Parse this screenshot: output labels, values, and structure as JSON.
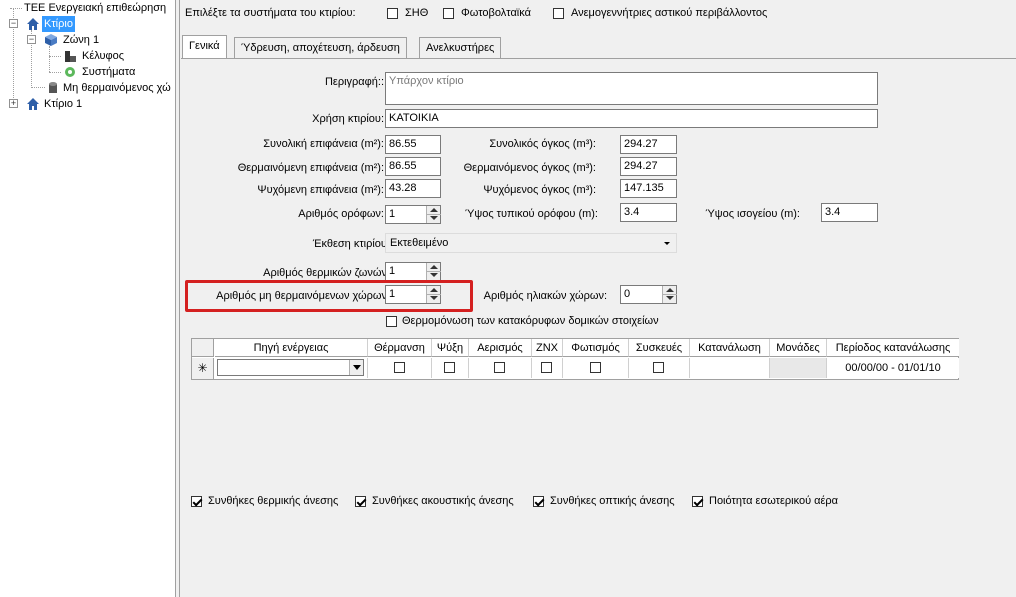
{
  "tree": {
    "items": [
      {
        "label": "ΤΕΕ Ενεργειακή επιθεώρηση",
        "icon": "root-dots"
      },
      {
        "label": "Κτίριο",
        "icon": "house-icon",
        "selected": true
      },
      {
        "label": "Ζώνη 1",
        "icon": "cube-icon"
      },
      {
        "label": "Κέλυφος",
        "icon": "wall-icon"
      },
      {
        "label": "Συστήματα",
        "icon": "systems-icon"
      },
      {
        "label": "Μη θερμαινόμενος χώ",
        "icon": "cylinder-icon"
      },
      {
        "label": "Κτίριο 1",
        "icon": "house-icon"
      }
    ]
  },
  "systems_bar": {
    "label": "Επιλέξτε τα συστήματα του κτιρίου:",
    "options": [
      {
        "label": "ΣΗΘ",
        "checked": false
      },
      {
        "label": "Φωτοβολταϊκά",
        "checked": false
      },
      {
        "label": "Ανεμογεννήτριες αστικού περιβάλλοντος",
        "checked": false
      }
    ]
  },
  "tabs": [
    {
      "label": "Γενικά",
      "active": true
    },
    {
      "label": "Ύδρευση, αποχέτευση, άρδευση",
      "active": false
    },
    {
      "label": "Ανελκυστήρες",
      "active": false
    }
  ],
  "form": {
    "description_label": "Περιγραφή::",
    "description_value": "Υπάρχον κτίριο",
    "usage_label": "Χρήση κτιρίου:",
    "usage_value": "ΚΑΤΟΙΚΙΑ",
    "total_area_label": "Συνολική επιφάνεια (m²):",
    "total_area": "86.55",
    "total_volume_label": "Συνολικός όγκος (m³):",
    "total_volume": "294.27",
    "heated_area_label": "Θερμαινόμενη επιφάνεια (m²):",
    "heated_area": "86.55",
    "heated_volume_label": "Θερμαινόμενος όγκος (m³):",
    "heated_volume": "294.27",
    "cooled_area_label": "Ψυχόμενη επιφάνεια (m²):",
    "cooled_area": "43.28",
    "cooled_volume_label": "Ψυχόμενος όγκος (m³):",
    "cooled_volume": "147.135",
    "floors_label": "Αριθμός ορόφων:",
    "floors": "1",
    "floor_height_label": "Ύψος τυπικού ορόφου (m):",
    "floor_height": "3.4",
    "ground_height_label": "Ύψος ισογείου (m):",
    "ground_height": "3.4",
    "exposure_label": "Έκθεση κτιρίου:",
    "exposure_value": "Εκτεθειμένο",
    "thermal_zones_label": "Αριθμός θερμικών ζωνών:",
    "thermal_zones": "1",
    "unheated_spaces_label": "Αριθμός μη θερμαινόμενων χώρων:",
    "unheated_spaces": "1",
    "solar_spaces_label": "Αριθμός ηλιακών χώρων:",
    "solar_spaces": "0",
    "insulation_label": "Θερμομόνωση των  κατακόρυφων δομικών στοιχείων",
    "insulation_checked": false
  },
  "grid": {
    "columns": [
      "Πηγή ενέργειας",
      "Θέρμανση",
      "Ψύξη",
      "Αερισμός",
      "ΖΝΧ",
      "Φωτισμός",
      "Συσκευές",
      "Κατανάλωση",
      "Μονάδες",
      "Περίοδος κατανάλωσης"
    ],
    "new_row_marker": "✳",
    "new_row_period": "00/00/00 - 01/01/10"
  },
  "comfort": [
    {
      "label": "Συνθήκες θερμικής άνεσης",
      "checked": true
    },
    {
      "label": "Συνθήκες ακουστικής άνεσης",
      "checked": true
    },
    {
      "label": "Συνθήκες οπτικής άνεσης",
      "checked": true
    },
    {
      "label": "Ποιότητα εσωτερικού αέρα",
      "checked": true
    }
  ],
  "colors": {
    "selection": "#3399ff",
    "highlight_box": "#d42020"
  }
}
